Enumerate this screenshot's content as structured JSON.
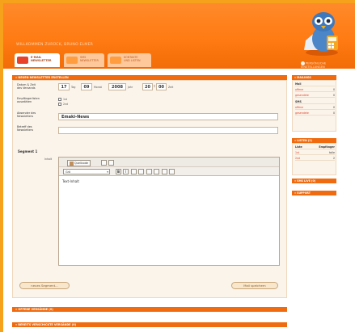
{
  "header": {
    "welcome": "WILLKOMMEN ZURÜCK, BRUNO ELMER",
    "settings": [
      "PERSÖNLICHE",
      "EINSTELLUNGEN"
    ]
  },
  "tabs": [
    {
      "line1": "E-MAIL",
      "line2": "NEWSLETTER",
      "active": true
    },
    {
      "line1": "SMS",
      "line2": "NEWSLETTER",
      "active": false
    },
    {
      "line1": "KONTAKTE",
      "line2": "UND LISTEN",
      "active": false
    }
  ],
  "main": {
    "section_title": "» NEUEN NEWSLETTER ERSTELLEN",
    "date_label": [
      "Datum & Zeit",
      "des Versands"
    ],
    "date": {
      "day": "17",
      "day_unit": "Tag",
      "month": "09",
      "month_unit": "Monat",
      "year": "2008",
      "year_unit": "Jahr",
      "hour": "20",
      "minute": "00",
      "time_unit": "Zeit"
    },
    "recipients_label": [
      "Empfängerlisten",
      "auswählen"
    ],
    "recipients": [
      {
        "label": "1st",
        "checked": false
      },
      {
        "label": "2nd",
        "checked": false
      }
    ],
    "sender_label": [
      "Absender des",
      "Newsletters"
    ],
    "sender_value": "Emaki-News",
    "subject_label": [
      "Betreff des",
      "Newsletters"
    ],
    "subject_value": "",
    "segment_title": "Segment 1",
    "segment_content_label": "Inhalt",
    "editor": {
      "source_label": "Quellcode",
      "size_value": "Grö",
      "bold": "B",
      "italic": "I",
      "text": "Text-Inhalt"
    },
    "new_segment_button": "neues Segment...",
    "save_button": "Mail speichern"
  },
  "bottom_sections": {
    "open": "» OFFENE VERSÄNDE (0)",
    "sent": "» BEREITS VERSCHICKTE VERSÄNDE (0)"
  },
  "sidebar": {
    "mailings_title": "» MAILINGS",
    "mail_header": "Mail",
    "mail_rows": [
      {
        "label": "offene",
        "value": "0"
      },
      {
        "label": "gesendete",
        "value": "0"
      }
    ],
    "sms_header": "SMS",
    "sms_rows": [
      {
        "label": "offene",
        "value": "0"
      },
      {
        "label": "gesendete",
        "value": "0"
      }
    ],
    "lists_title": "» LISTEN (2)",
    "lists_header": {
      "col1": "Liste",
      "col2": "Empfänger"
    },
    "lists_rows": [
      {
        "label": "1st",
        "value": "tolle"
      },
      {
        "label": "2nd",
        "value": "2"
      }
    ],
    "sms_live_title": "» SMS LIVE (0)",
    "support_title": "» SUPPORT"
  },
  "colors": {
    "accent": "#f06b10",
    "frame": "#f6a21a",
    "link": "#e2402a"
  }
}
